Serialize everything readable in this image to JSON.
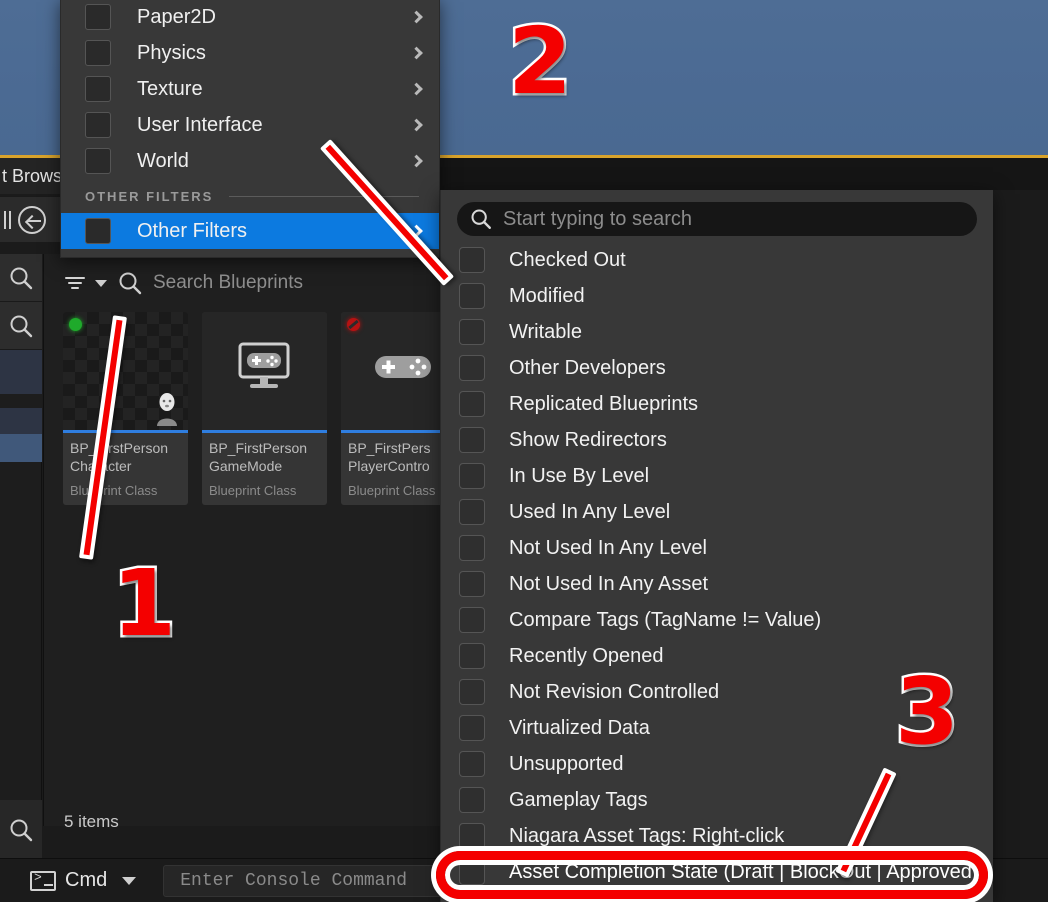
{
  "app": {
    "viewport_name": "level-viewport"
  },
  "content_browser": {
    "tab_label": "t Brows",
    "search_placeholder": "Search Blueprints",
    "items_count": "5 items",
    "filter_icon": "filter-icon",
    "chevron_icon": "chevron-down-icon",
    "assets": [
      {
        "name": "BP_FirstPerson\nCharacter",
        "type": "Blueprint Class",
        "badge": "green",
        "thumb": "checker"
      },
      {
        "name": "BP_FirstPerson\nGameMode",
        "type": "Blueprint Class",
        "badge": "none",
        "thumb": "monitor-gamepad"
      },
      {
        "name": "BP_FirstPers\nPlayerContro",
        "type": "Blueprint Class",
        "badge": "red",
        "thumb": "gamepad"
      }
    ]
  },
  "console": {
    "mode_label": "Cmd",
    "placeholder": "Enter Console Command",
    "terminal_icon": "terminal-icon",
    "chevron_icon": "chevron-down-icon"
  },
  "filter_menu": {
    "items": [
      {
        "label": "Paper2D",
        "has_submenu": true,
        "checked": false
      },
      {
        "label": "Physics",
        "has_submenu": true,
        "checked": false
      },
      {
        "label": "Texture",
        "has_submenu": true,
        "checked": false
      },
      {
        "label": "User Interface",
        "has_submenu": true,
        "checked": false
      },
      {
        "label": "World",
        "has_submenu": true,
        "checked": false
      }
    ],
    "section_header": "OTHER FILTERS",
    "selected_item": {
      "label": "Other Filters",
      "has_submenu": true,
      "checked": false
    },
    "highlight_color": "#0c7ae0"
  },
  "submenu": {
    "search_placeholder": "Start typing to search",
    "search_icon": "search-icon",
    "items": [
      {
        "label": "Checked Out",
        "checked": false
      },
      {
        "label": "Modified",
        "checked": false
      },
      {
        "label": "Writable",
        "checked": false
      },
      {
        "label": "Other Developers",
        "checked": false
      },
      {
        "label": "Replicated Blueprints",
        "checked": false
      },
      {
        "label": "Show Redirectors",
        "checked": false
      },
      {
        "label": "In Use By Level",
        "checked": false
      },
      {
        "label": "Used In Any Level",
        "checked": false
      },
      {
        "label": "Not Used In Any Level",
        "checked": false
      },
      {
        "label": "Not Used In Any Asset",
        "checked": false
      },
      {
        "label": "Compare Tags (TagName != Value)",
        "checked": false
      },
      {
        "label": "Recently Opened",
        "checked": false
      },
      {
        "label": "Not Revision Controlled",
        "checked": false
      },
      {
        "label": "Virtualized Data",
        "checked": false
      },
      {
        "label": "Unsupported",
        "checked": false
      },
      {
        "label": "Gameplay Tags",
        "checked": false
      },
      {
        "label": "Niagara Asset Tags: Right-click",
        "checked": false
      },
      {
        "label": "Asset Completion State (Draft | BlockOut | Approved)",
        "checked": false
      }
    ]
  },
  "annotations": {
    "color": "#f40000",
    "outline": "#ffffff",
    "steps": [
      {
        "number": "1",
        "points_to": "filter-icon"
      },
      {
        "number": "2",
        "points_to": "other-filters-menu-item"
      },
      {
        "number": "3",
        "points_to": "asset-completion-state-filter"
      }
    ]
  }
}
